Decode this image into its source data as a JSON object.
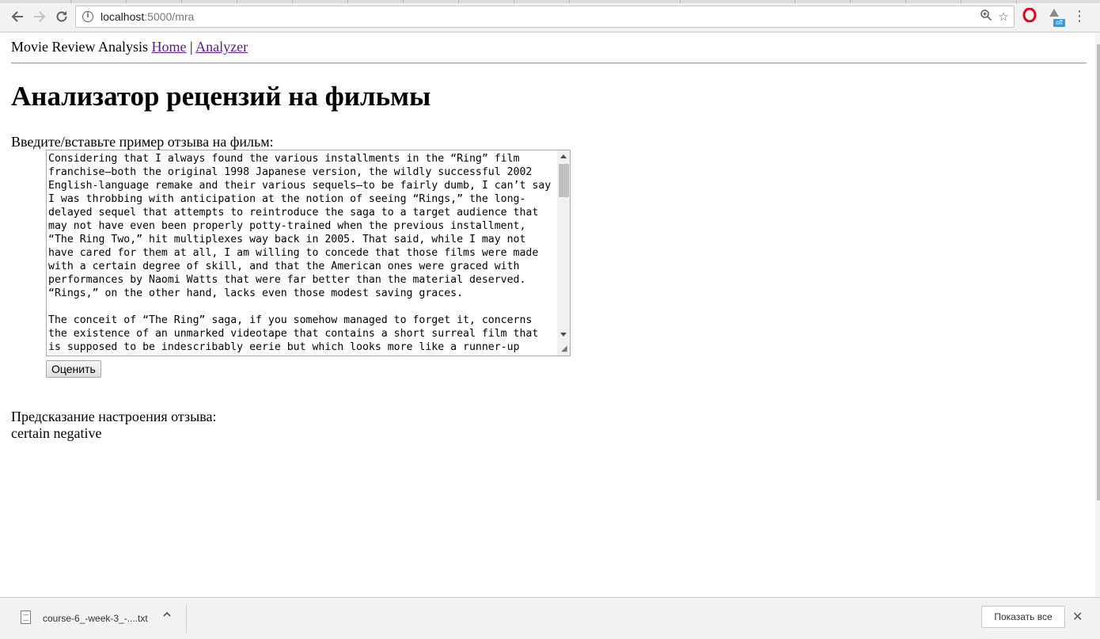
{
  "browser": {
    "url_host": "localhost",
    "url_path": ":5000/mra"
  },
  "nav": {
    "brand": "Movie Review Analysis",
    "home": "Home",
    "separator": "|",
    "analyzer": "Analyzer"
  },
  "main": {
    "heading": "Анализатор рецензий на фильмы",
    "input_label": "Введите/вставьте пример отзыва на фильм:",
    "review_text": "Considering that I always found the various installments in the “Ring” film franchise—both the original 1998 Japanese version, the wildly successful 2002 English-language remake and their various sequels—to be fairly dumb, I can’t say I was throbbing with anticipation at the notion of seeing “Rings,” the long-delayed sequel that attempts to reintroduce the saga to a target audience that may not have even been properly potty-trained when the previous installment, “The Ring Two,” hit multiplexes way back in 2005. That said, while I may not have cared for them at all, I am willing to concede that those films were made with a certain degree of skill, and that the American ones were graced with performances by Naomi Watts that were far better than the material deserved. “Rings,” on the other hand, lacks even those modest saving graces.\n\nThe conceit of “The Ring” saga, if you somehow managed to forget it, concerns the existence of an unmarked videotape that contains a short surreal film that is supposed to be indescribably eerie but which looks more like a runner-up",
    "submit_label": "Оценить",
    "prediction_label": "Предсказание настроения отзыва:",
    "prediction_value": "certain negative"
  },
  "download_shelf": {
    "file_name": "course-6_-week-3_-....txt",
    "show_all_label": "Показать все"
  },
  "icons": {
    "back": "back-arrow-icon",
    "forward": "forward-arrow-icon",
    "reload": "reload-icon",
    "info": "info-icon",
    "zoom": "zoom-icon",
    "star": "bookmark-star-icon",
    "opera": "opera-icon",
    "vpn": "vpn-extension-icon",
    "menu": "kebab-menu-icon",
    "file": "text-file-icon",
    "chevron": "chevron-up-icon",
    "close": "close-icon"
  },
  "colors": {
    "link_visited": "#551a8b",
    "opera_red": "#e0001a",
    "badge_blue": "#3a9ad9"
  },
  "vpn_badge": "off"
}
